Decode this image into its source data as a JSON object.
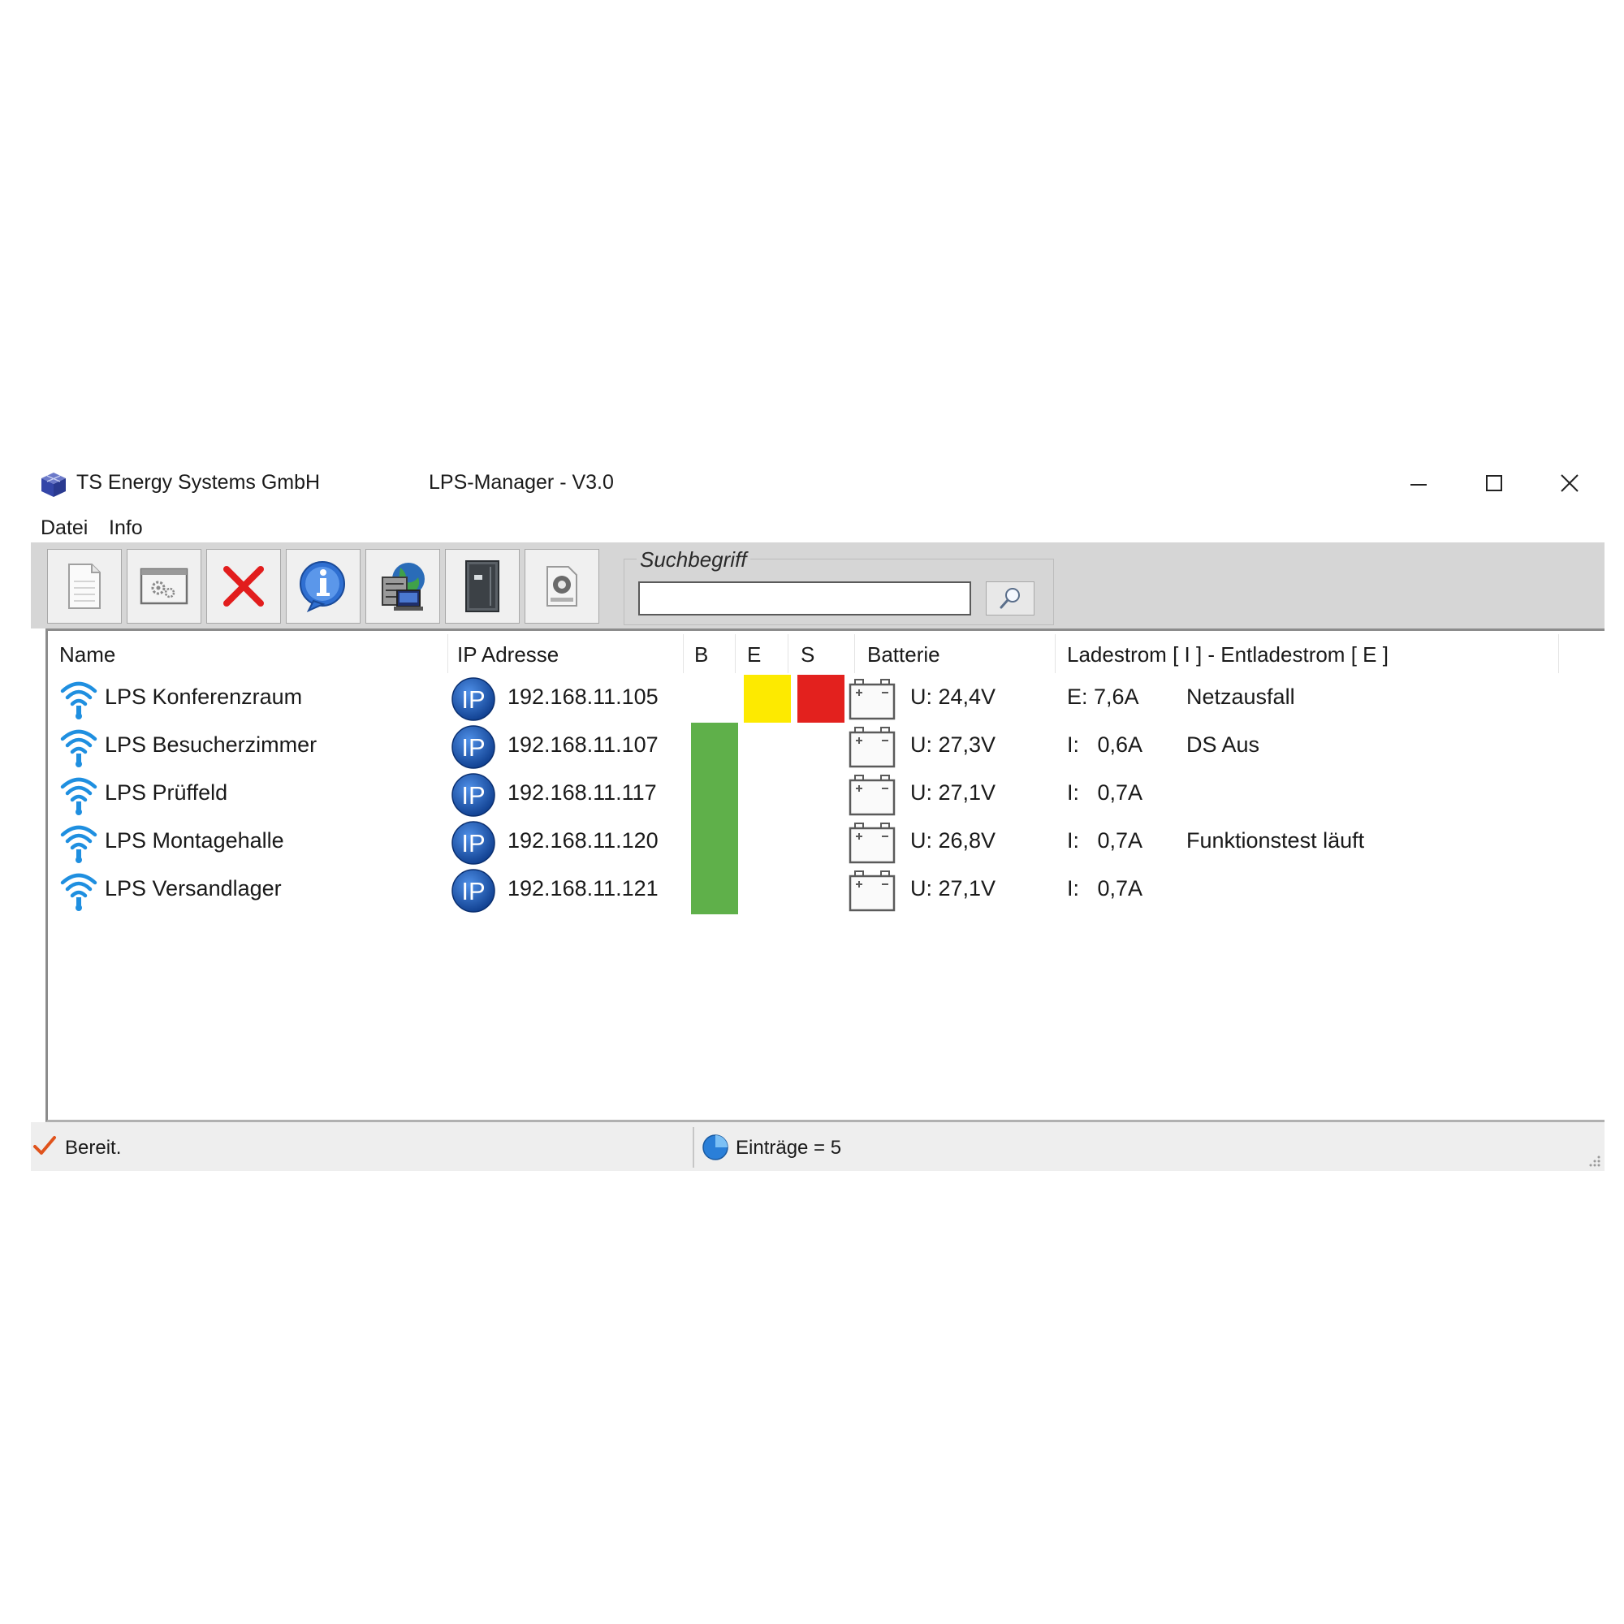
{
  "titlebar": {
    "company": "TS Energy Systems GmbH",
    "app_title": "LPS-Manager - V3.0"
  },
  "menu": {
    "items": [
      {
        "label": "Datei"
      },
      {
        "label": "Info"
      }
    ]
  },
  "toolbar": {
    "buttons": [
      "document-icon",
      "settings-window-icon",
      "delete-x-icon",
      "info-icon",
      "network-computer-icon",
      "device-cabinet-icon",
      "config-icon"
    ],
    "search": {
      "label": "Suchbegriff",
      "value": "",
      "placeholder": ""
    }
  },
  "table": {
    "columns": [
      "Name",
      "IP Adresse",
      "B",
      "E",
      "S",
      "Batterie",
      "Ladestrom [ I ] - Entladestrom [ E ]"
    ],
    "rows": [
      {
        "name": "LPS  Konferenzraum",
        "ip": "192.168.11.105",
        "b": "",
        "e": "#fdea00",
        "s": "#e3211e",
        "battery": "U: 24,4V",
        "current": "E: 7,6A",
        "note": "Netzausfall"
      },
      {
        "name": "LPS Besucherzimmer",
        "ip": "192.168.11.107",
        "b": "#5fb04a",
        "e": "",
        "s": "",
        "battery": "U: 27,3V",
        "current": "I:   0,6A",
        "note": "DS Aus"
      },
      {
        "name": "LPS Prüffeld",
        "ip": "192.168.11.117",
        "b": "#5fb04a",
        "e": "",
        "s": "",
        "battery": "U: 27,1V",
        "current": "I:   0,7A",
        "note": ""
      },
      {
        "name": "LPS Montagehalle",
        "ip": "192.168.11.120",
        "b": "#5fb04a",
        "e": "",
        "s": "",
        "battery": "U: 26,8V",
        "current": "I:   0,7A",
        "note": "Funktionstest läuft"
      },
      {
        "name": "LPS Versandlager",
        "ip": "192.168.11.121",
        "b": "#5fb04a",
        "e": "",
        "s": "",
        "battery": "U: 27,1V",
        "current": "I:   0,7A",
        "note": ""
      }
    ]
  },
  "statusbar": {
    "status": "Bereit.",
    "entries": "Einträge = 5"
  },
  "colors": {
    "accent_blue": "#1565c0",
    "ok_green": "#5fb04a",
    "warn_yellow": "#fdea00",
    "alarm_red": "#e3211e",
    "toolbar_gray": "#d6d6d6"
  }
}
